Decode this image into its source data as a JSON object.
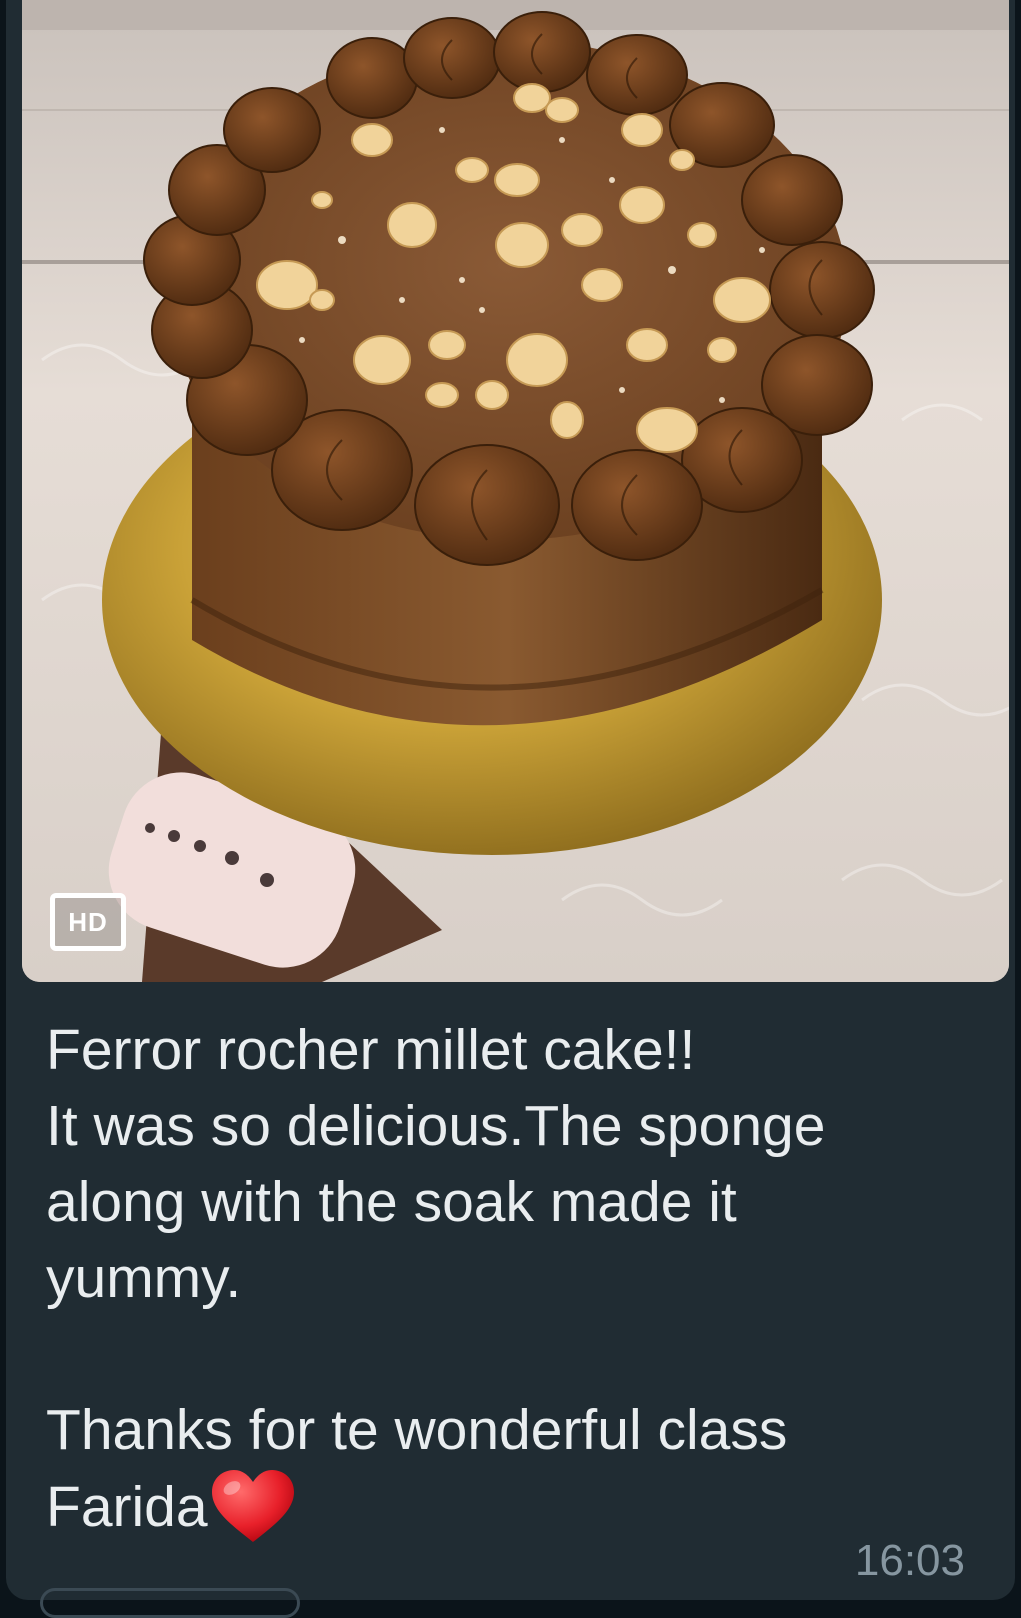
{
  "message": {
    "image_alt": "chocolate hazelnut cake on gold board",
    "hd_badge": "HD",
    "caption_lines": [
      "Ferror rocher millet cake!!",
      "It was so delicious.The sponge",
      "along with the soak made it",
      "yummy.",
      "",
      "Thanks for te wonderful class"
    ],
    "caption_last": "Farida",
    "emoji": "heart-emoji",
    "time": "16:03"
  },
  "colors": {
    "chat_background": "#0b141a",
    "bubble": "#202c33",
    "text": "#e9edef",
    "timestamp": "#8696a0"
  }
}
